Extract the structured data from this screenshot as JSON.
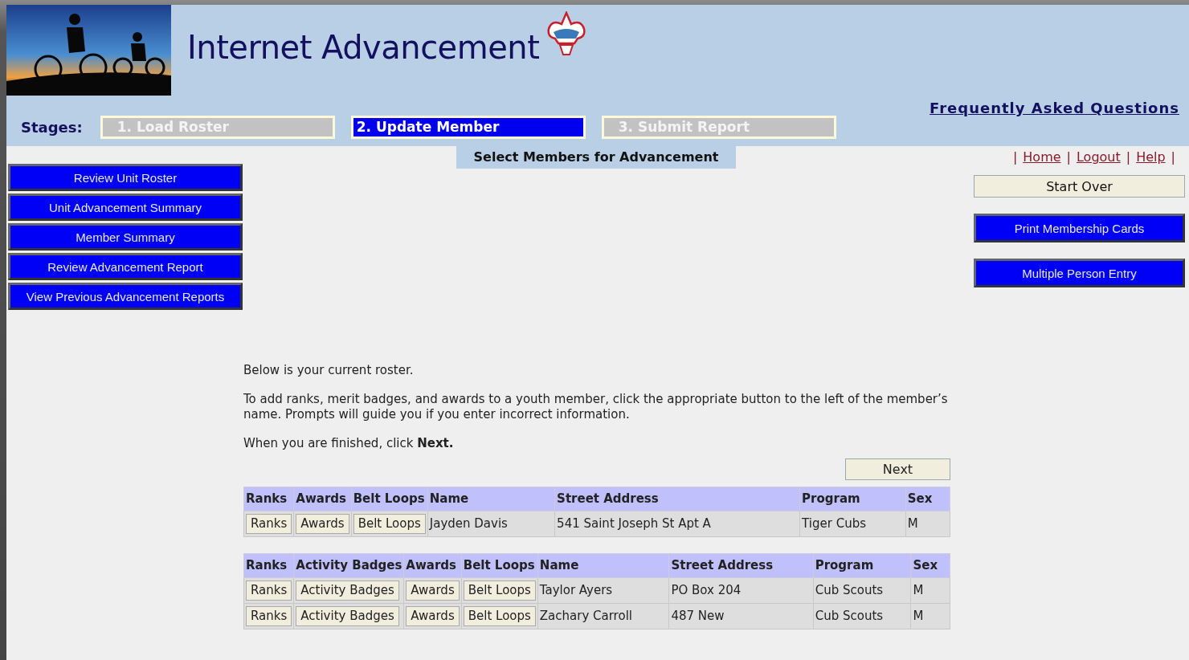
{
  "header": {
    "title": "Internet Advancement",
    "faq_link": "Frequently Asked Questions"
  },
  "stages": {
    "label": "Stages:",
    "items": [
      {
        "label": "1. Load Roster",
        "selected": false
      },
      {
        "label": "2. Update Member",
        "selected": true
      },
      {
        "label": "3. Submit Report",
        "selected": false
      }
    ]
  },
  "page_heading": "Select Members for Advancement",
  "top_links": [
    {
      "kind": "separator",
      "text": "|"
    },
    {
      "kind": "link",
      "text": "Home"
    },
    {
      "kind": "separator",
      "text": "|"
    },
    {
      "kind": "link",
      "text": "Logout"
    },
    {
      "kind": "separator",
      "text": "|"
    },
    {
      "kind": "link",
      "text": "Help"
    },
    {
      "kind": "separator",
      "text": "|"
    }
  ],
  "sidebar": {
    "buttons": [
      "Review Unit Roster",
      "Unit Advancement Summary",
      "Member Summary",
      "Review Advancement Report",
      "View Previous Advancement Reports"
    ]
  },
  "actions": [
    {
      "kind": "plain",
      "label": "Start Over"
    },
    {
      "kind": "primary",
      "label": "Print Membership Cards"
    },
    {
      "kind": "primary",
      "label": "Multiple Person Entry"
    }
  ],
  "instructions": [
    "Below is your current roster.",
    "To add ranks, merit badges, and awards to a youth member, click the appropriate button to the left of the member’s name.  Prompts will guide you if you enter incorrect information.",
    "When you are finished, click **Next.**"
  ],
  "next_button": "Next",
  "tables": [
    {
      "columns": [
        "Ranks",
        "Awards",
        "Belt Loops",
        "Name",
        "Street Address",
        "Program",
        "Sex"
      ],
      "rows": [
        {
          "cells": [
            {
              "kind": "button",
              "text": "Ranks"
            },
            {
              "kind": "button",
              "text": "Awards"
            },
            {
              "kind": "button",
              "text": "Belt Loops"
            },
            {
              "kind": "text",
              "text": "Jayden Davis"
            },
            {
              "kind": "text",
              "text": "541 Saint Joseph St Apt A"
            },
            {
              "kind": "text",
              "text": "Tiger Cubs"
            },
            {
              "kind": "text",
              "text": "M"
            }
          ]
        }
      ]
    },
    {
      "columns": [
        "Ranks",
        "Activity Badges",
        "Awards",
        "Belt Loops",
        "Name",
        "Street Address",
        "Program",
        "Sex"
      ],
      "rows": [
        {
          "cells": [
            {
              "kind": "button",
              "text": "Ranks"
            },
            {
              "kind": "button",
              "text": "Activity Badges"
            },
            {
              "kind": "button",
              "text": "Awards"
            },
            {
              "kind": "button",
              "text": "Belt Loops"
            },
            {
              "kind": "text",
              "text": "Taylor Ayers"
            },
            {
              "kind": "text",
              "text": "PO Box 204"
            },
            {
              "kind": "text",
              "text": "Cub Scouts"
            },
            {
              "kind": "text",
              "text": "M"
            }
          ]
        },
        {
          "cells": [
            {
              "kind": "button",
              "text": "Ranks"
            },
            {
              "kind": "button",
              "text": "Activity Badges"
            },
            {
              "kind": "button",
              "text": "Awards"
            },
            {
              "kind": "button",
              "text": "Belt Loops"
            },
            {
              "kind": "text",
              "text": "Zachary Carroll"
            },
            {
              "kind": "text",
              "text": "487 New"
            },
            {
              "kind": "text",
              "text": "Cub Scouts"
            },
            {
              "kind": "text",
              "text": "M"
            }
          ]
        }
      ]
    }
  ]
}
